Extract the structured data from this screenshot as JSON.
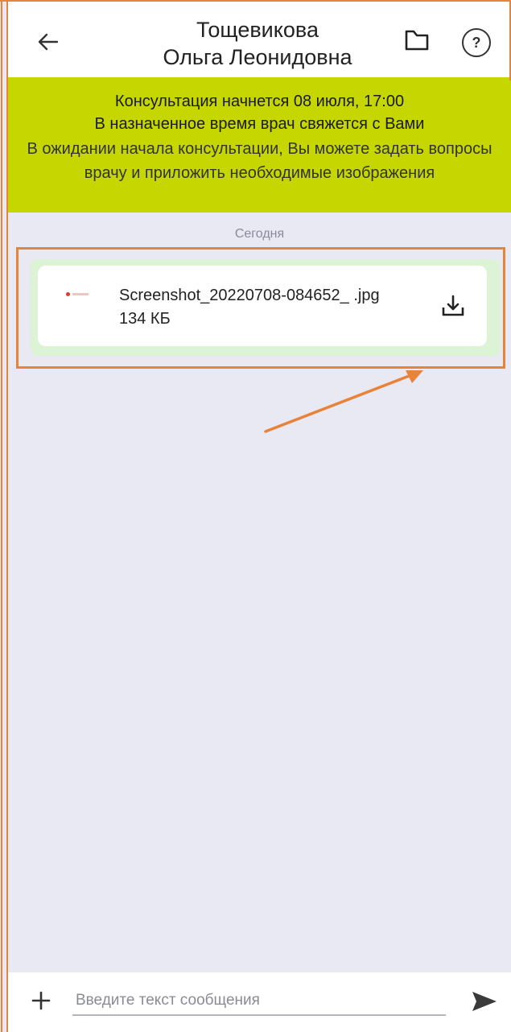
{
  "header": {
    "title_line1": "Тощевикова",
    "title_line2": "Ольга Леонидовна",
    "back_icon": "arrow-left-icon",
    "folder_icon": "folder-icon",
    "help_label": "?"
  },
  "banner": {
    "line1": "Консультация начнется 08 июля, 17:00",
    "line2": "В назначенное время врач свяжется с Вами",
    "line3": "В ожидании начала консультации, Вы можете задать вопросы врачу и приложить необходимые изображения",
    "background": "#c6d600"
  },
  "chat": {
    "date_separator": "Сегодня",
    "messages": [
      {
        "type": "file",
        "file_name": "Screenshot_20220708-084652_ .jpg",
        "file_size": "134 КБ",
        "action_icon": "download-icon"
      }
    ]
  },
  "input": {
    "placeholder": "Введите текст сообщения",
    "value": "",
    "attach_icon": "plus-icon",
    "send_icon": "send-icon"
  },
  "colors": {
    "annotation": "#e8833a",
    "chat_background": "#e9e9f3",
    "bubble": "#dcf3d6"
  }
}
